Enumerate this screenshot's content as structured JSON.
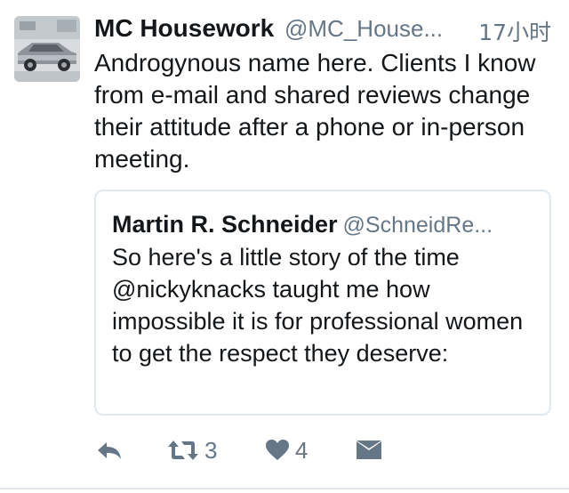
{
  "tweet": {
    "author_name": "MC Housework",
    "author_handle": "@MC_House...",
    "timestamp": "17小时",
    "text": "Androgynous name here. Clients I know from e-mail and shared reviews change their attitude after a phone or in-person meeting."
  },
  "quoted_tweet": {
    "author_name": "Martin R. Schneider",
    "author_handle": "@SchneidRe...",
    "text": "So here's a little story of the time @nickyknacks taught me how impossible it is for professional women to get the respect they deserve:"
  },
  "actions": {
    "reply_icon": "reply-icon",
    "retweet_icon": "retweet-icon",
    "retweet_count": "3",
    "like_icon": "heart-icon",
    "like_count": "4",
    "dm_icon": "envelope-icon"
  },
  "colors": {
    "text": "#14171a",
    "secondary": "#657786",
    "border": "#e1e8ed"
  }
}
